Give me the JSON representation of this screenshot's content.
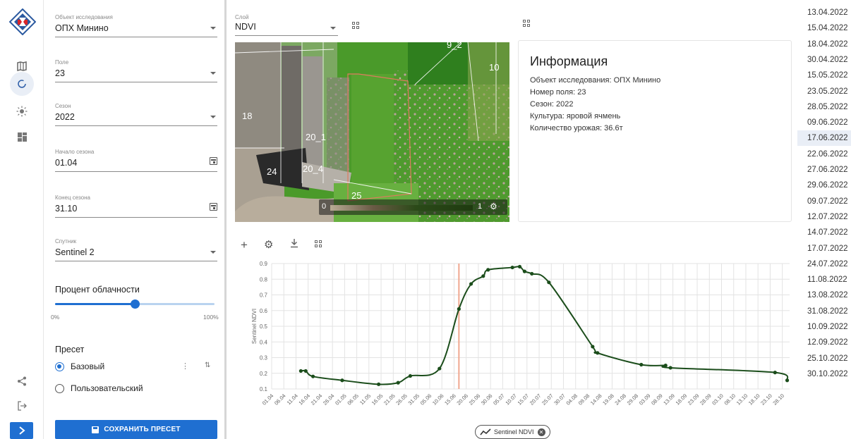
{
  "colors": {
    "accent": "#1f6fd1",
    "line": "#1b4d1b",
    "marker": "#f0a890"
  },
  "rail": {
    "icons": [
      "map-icon",
      "refresh-icon",
      "sun-icon",
      "dashboard-icon",
      "share-icon",
      "logout-icon",
      "chevron-right-icon"
    ]
  },
  "panel": {
    "object": {
      "label": "Объект исследования",
      "value": "ОПХ Минино"
    },
    "field": {
      "label": "Поле",
      "value": "23"
    },
    "season": {
      "label": "Сезон",
      "value": "2022"
    },
    "season_start": {
      "label": "Начало сезона",
      "value": "01.04"
    },
    "season_end": {
      "label": "Конец сезона",
      "value": "31.10"
    },
    "satellite": {
      "label": "Спутник",
      "value": "Sentinel 2"
    },
    "cloud": {
      "title": "Процент облачности",
      "min": "0%",
      "max": "100%",
      "value_percent": 50
    },
    "preset": {
      "title": "Пресет",
      "options": [
        "Базовый",
        "Пользовательский"
      ],
      "selected": "Базовый"
    },
    "save_label": "СОХРАНИТЬ ПРЕСЕТ"
  },
  "layer": {
    "label": "Слой",
    "value": "NDVI"
  },
  "map": {
    "field_labels": [
      "9_2",
      "10",
      "18",
      "20_1",
      "24",
      "20_4",
      "25"
    ],
    "scale_min": "0",
    "scale_max": "1"
  },
  "info": {
    "title": "Информация",
    "lines": [
      "Объект исследования: ОПХ Минино",
      "Номер поля: 23",
      "Сезон: 2022",
      "Культура: яровой ячмень",
      "Количество урожая: 36.6т"
    ]
  },
  "dates": {
    "items": [
      "13.04.2022",
      "15.04.2022",
      "18.04.2022",
      "30.04.2022",
      "15.05.2022",
      "23.05.2022",
      "28.05.2022",
      "09.06.2022",
      "17.06.2022",
      "22.06.2022",
      "27.06.2022",
      "29.06.2022",
      "09.07.2022",
      "12.07.2022",
      "14.07.2022",
      "17.07.2022",
      "24.07.2022",
      "11.08.2022",
      "13.08.2022",
      "31.08.2022",
      "10.09.2022",
      "12.09.2022",
      "25.10.2022",
      "30.10.2022"
    ],
    "selected": "17.06.2022"
  },
  "chart_data": {
    "type": "line",
    "ylabel": "Sentinel NDVI",
    "ylim": [
      0.1,
      0.9
    ],
    "yticks": [
      "0.1",
      "0.2",
      "0.3",
      "0.4",
      "0.5",
      "0.6",
      "0.7",
      "0.8",
      "0.9"
    ],
    "xticks": [
      "01.04",
      "06.04",
      "11.04",
      "16.04",
      "21.04",
      "26.04",
      "01.05",
      "06.05",
      "11.05",
      "16.05",
      "21.05",
      "26.05",
      "31.05",
      "05.06",
      "10.06",
      "15.06",
      "20.06",
      "25.06",
      "30.06",
      "05.07",
      "10.07",
      "15.07",
      "20.07",
      "25.07",
      "30.07",
      "04.08",
      "09.08",
      "14.08",
      "19.08",
      "24.08",
      "29.08",
      "03.09",
      "08.09",
      "13.09",
      "18.09",
      "23.09",
      "28.09",
      "03.10",
      "08.10",
      "13.10",
      "18.10",
      "23.10",
      "28.10"
    ],
    "grid": true,
    "marker_date": "17.06",
    "series": [
      {
        "name": "Sentinel NDVI",
        "points": [
          [
            "13.04",
            0.215
          ],
          [
            "15.04",
            0.215
          ],
          [
            "18.04",
            0.18
          ],
          [
            "30.04",
            0.155
          ],
          [
            "15.05",
            0.13
          ],
          [
            "23.05",
            0.14
          ],
          [
            "28.05",
            0.183
          ],
          [
            "09.06",
            0.23
          ],
          [
            "17.06",
            0.61
          ],
          [
            "22.06",
            0.77
          ],
          [
            "27.06",
            0.82
          ],
          [
            "29.06",
            0.86
          ],
          [
            "09.07",
            0.875
          ],
          [
            "12.07",
            0.88
          ],
          [
            "14.07",
            0.85
          ],
          [
            "17.07",
            0.835
          ],
          [
            "24.07",
            0.78
          ],
          [
            "11.08",
            0.37
          ],
          [
            "13.08",
            0.33
          ],
          [
            "31.08",
            0.255
          ],
          [
            "10.09",
            0.25
          ],
          [
            "12.09",
            0.235
          ],
          [
            "25.10",
            0.205
          ],
          [
            "30.10",
            0.155
          ]
        ]
      }
    ]
  }
}
